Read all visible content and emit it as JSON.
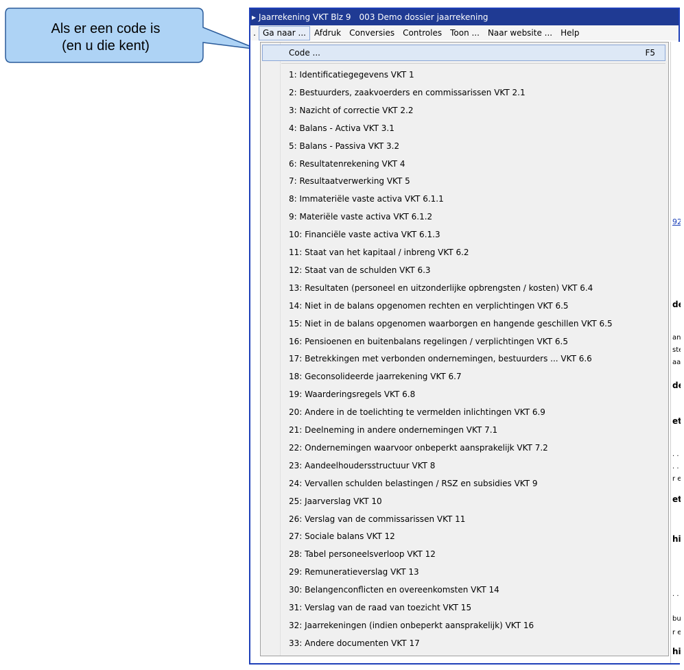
{
  "callout": {
    "line1": "Als er een code is",
    "line2": "(en u die kent)",
    "fill": "#aed3f5",
    "stroke": "#2a5b9a"
  },
  "window": {
    "title_arrow": "▸",
    "title_app": "Jaarrekening VKT Blz 9",
    "title_dossier": "003 Demo dossier jaarrekening",
    "title_bg": "#1f3a93"
  },
  "menubar": {
    "lead": ".",
    "items": [
      "Ga naar ...",
      "Afdruk",
      "Conversies",
      "Controles",
      "Toon ...",
      "Naar website ...",
      "Help"
    ]
  },
  "dropdown": {
    "code_label": "Code ...",
    "code_shortcut": "F5",
    "items": [
      "1: Identificatiegegevens VKT 1",
      "2: Bestuurders, zaakvoerders en commissarissen VKT 2.1",
      "3: Nazicht of correctie VKT 2.2",
      "4: Balans  - Activa VKT 3.1",
      "5: Balans - Passiva VKT 3.2",
      "6: Resultatenrekening VKT 4",
      "7: Resultaatverwerking VKT 5",
      "8: Immateriële vaste activa VKT 6.1.1",
      "9: Materiële vaste activa VKT 6.1.2",
      "10: Financiële vaste activa VKT 6.1.3",
      "11: Staat van het kapitaal / inbreng VKT 6.2",
      "12: Staat van de schulden VKT 6.3",
      "13: Resultaten (personeel en uitzonderlijke opbrengsten / kosten) VKT 6.4",
      "14: Niet in de balans opgenomen rechten en verplichtingen VKT 6.5",
      "15: Niet in de balans opgenomen waarborgen en hangende geschillen VKT 6.5",
      "16: Pensioenen en buitenbalans regelingen / verplichtingen VKT 6.5",
      "17: Betrekkingen met verbonden ondernemingen, bestuurders ... VKT 6.6",
      "18: Geconsolideerde jaarrekening VKT 6.7",
      "19: Waarderingsregels VKT 6.8",
      "20: Andere in de toelichting te vermelden inlichtingen VKT 6.9",
      "21: Deelneming in andere ondernemingen VKT 7.1",
      "22: Ondernemingen waarvoor onbeperkt aansprakelijk VKT 7.2",
      "23: Aandeelhoudersstructuur VKT 8",
      "24: Vervallen schulden belastingen / RSZ en subsidies VKT 9",
      "25: Jaarverslag VKT 10",
      "26: Verslag van de commissarissen VKT 11",
      "27: Sociale balans VKT 12",
      "28: Tabel personeelsverloop VKT 12",
      "29: Remuneratieverslag VKT 13",
      "30: Belangenconflicten en overeenkomsten VKT 14",
      "31: Verslag van de raad van toezicht VKT 15",
      "32: Jaarrekeningen (indien onbeperkt aansprakelijk) VKT 16",
      "33: Andere documenten VKT 17"
    ]
  },
  "background_fragments": {
    "f1": "92",
    "f2": "de",
    "f3": "an",
    "f4": "ste",
    "f5": "aar",
    "f6": "de",
    "f7": "et",
    "f8": ". .",
    "f9": ". .",
    "f10": "r e",
    "f11": "et",
    "f12": "hi",
    "f13": ". .",
    "f14": "bu",
    "f15": "r e",
    "f16": "hi"
  }
}
